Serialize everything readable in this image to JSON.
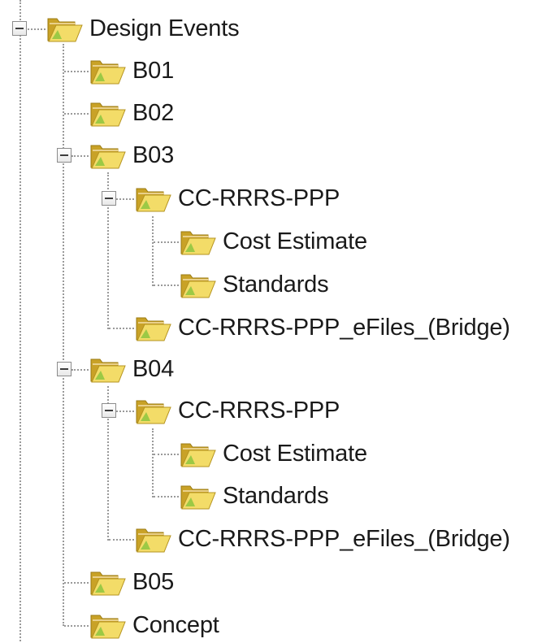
{
  "tree": {
    "nodes": [
      {
        "id": "design-events",
        "label": "Design Events",
        "icon": "open-folder-icon",
        "expanded": true
      },
      {
        "id": "b01",
        "label": "B01",
        "icon": "open-folder-icon"
      },
      {
        "id": "b02",
        "label": "B02",
        "icon": "open-folder-icon"
      },
      {
        "id": "b03",
        "label": "B03",
        "icon": "open-folder-icon",
        "expanded": true
      },
      {
        "id": "b03-cc",
        "label": "CC-RRRS-PPP",
        "icon": "open-folder-icon",
        "expanded": true
      },
      {
        "id": "b03-cc-cost",
        "label": "Cost Estimate",
        "icon": "open-folder-icon"
      },
      {
        "id": "b03-cc-standards",
        "label": "Standards",
        "icon": "open-folder-icon"
      },
      {
        "id": "b03-efiles",
        "label": "CC-RRRS-PPP_eFiles_(Bridge)",
        "icon": "open-folder-icon"
      },
      {
        "id": "b04",
        "label": "B04",
        "icon": "open-folder-icon",
        "expanded": true
      },
      {
        "id": "b04-cc",
        "label": "CC-RRRS-PPP",
        "icon": "open-folder-icon",
        "expanded": true
      },
      {
        "id": "b04-cc-cost",
        "label": "Cost Estimate",
        "icon": "open-folder-icon"
      },
      {
        "id": "b04-cc-standards",
        "label": "Standards",
        "icon": "open-folder-icon"
      },
      {
        "id": "b04-efiles",
        "label": "CC-RRRS-PPP_eFiles_(Bridge)",
        "icon": "open-folder-icon"
      },
      {
        "id": "b05",
        "label": "B05",
        "icon": "open-folder-icon"
      },
      {
        "id": "concept",
        "label": "Concept",
        "icon": "open-folder-icon"
      }
    ]
  },
  "colors": {
    "folder_back": "#c9a227",
    "folder_front": "#f3dc68",
    "folder_accent": "#8cc63f",
    "connector": "#9a9a9a",
    "text": "#1a1a1a"
  }
}
